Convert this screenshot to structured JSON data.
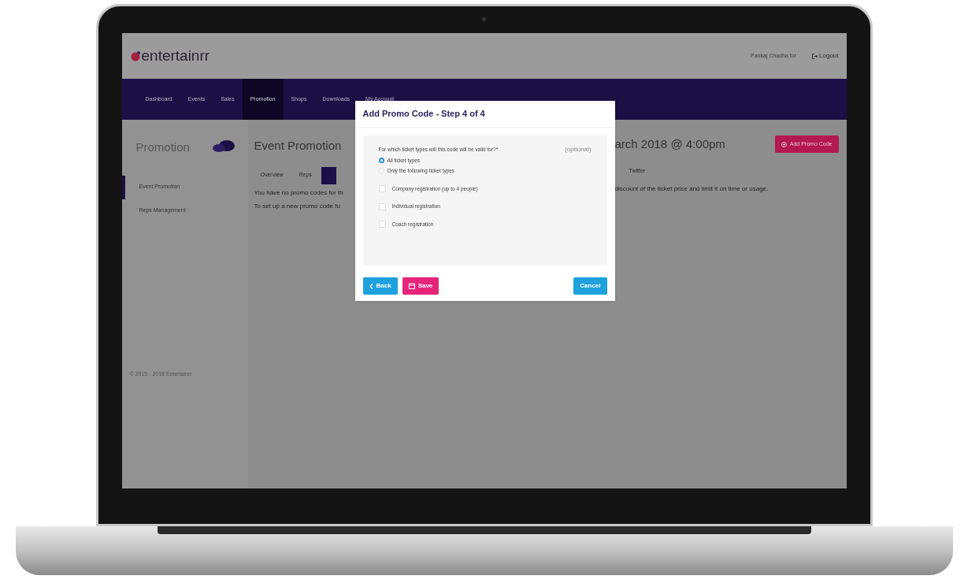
{
  "header": {
    "logo": "entertainrr",
    "user": "Pankaj Chadha for",
    "logout": "Logout"
  },
  "nav": [
    {
      "label": "Dashboard",
      "selected": false
    },
    {
      "label": "Events",
      "selected": false
    },
    {
      "label": "Sales",
      "selected": false
    },
    {
      "label": "Promotion",
      "selected": true
    },
    {
      "label": "Shops",
      "selected": false
    },
    {
      "label": "Downloads",
      "selected": false
    },
    {
      "label": "My Account",
      "selected": false
    }
  ],
  "sidebar": {
    "title": "Promotion",
    "items": [
      {
        "label": "Event Promotion",
        "selected": true
      },
      {
        "label": "Reps Management",
        "selected": false
      }
    ],
    "footer": "© 2015 - 2018 Entertainrr"
  },
  "main": {
    "title_left": "Event Promotion",
    "title_right": "arch 2018 @ 4:00pm",
    "add_button": "Add Promo Code",
    "tabs_left": [
      {
        "label": "Overview",
        "selected": false
      },
      {
        "label": "Reps",
        "selected": false
      },
      {
        "selected": true
      }
    ],
    "tabs_right": [
      {
        "label": "Twitter",
        "selected": false
      }
    ],
    "text_left": [
      "You have no promo codes for th",
      "To set up a new promo code fo"
    ],
    "text_right": [
      "discount of the ticket price and limit it on time or usage."
    ]
  },
  "modal": {
    "title": "Add Promo Code - Step 4 of 4",
    "question": "For which ticket types will this code will be valid for?*",
    "hint": "(optional)",
    "radios": [
      {
        "label": "All ticket types",
        "selected": true
      },
      {
        "label": "Only the following ticket types",
        "selected": false
      }
    ],
    "checkboxes": [
      {
        "label": "Company registration (up to 4 people)",
        "checked": false
      },
      {
        "label": "Individual registration",
        "checked": false
      },
      {
        "label": "Coach registration",
        "checked": false
      }
    ],
    "buttons": [
      {
        "kind": "back",
        "label": "Back"
      },
      {
        "kind": "save",
        "label": "Save"
      },
      {
        "kind": "cancel",
        "label": "Cancel"
      }
    ]
  }
}
